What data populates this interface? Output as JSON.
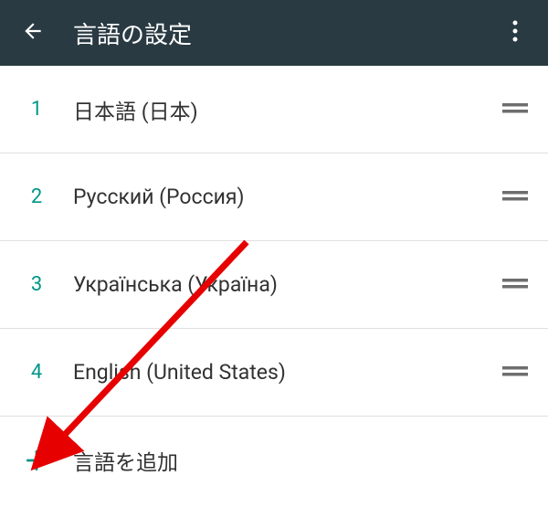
{
  "header": {
    "title": "言語の設定"
  },
  "languages": [
    {
      "index": "1",
      "label": "日本語 (日本)"
    },
    {
      "index": "2",
      "label": "Русский (Россия)"
    },
    {
      "index": "3",
      "label": "Українська (Україна)"
    },
    {
      "index": "4",
      "label": "English (United States)"
    }
  ],
  "add": {
    "label": "言語を追加"
  },
  "colors": {
    "header_bg": "#2a3a42",
    "accent": "#009688",
    "arrow": "#e60000"
  }
}
